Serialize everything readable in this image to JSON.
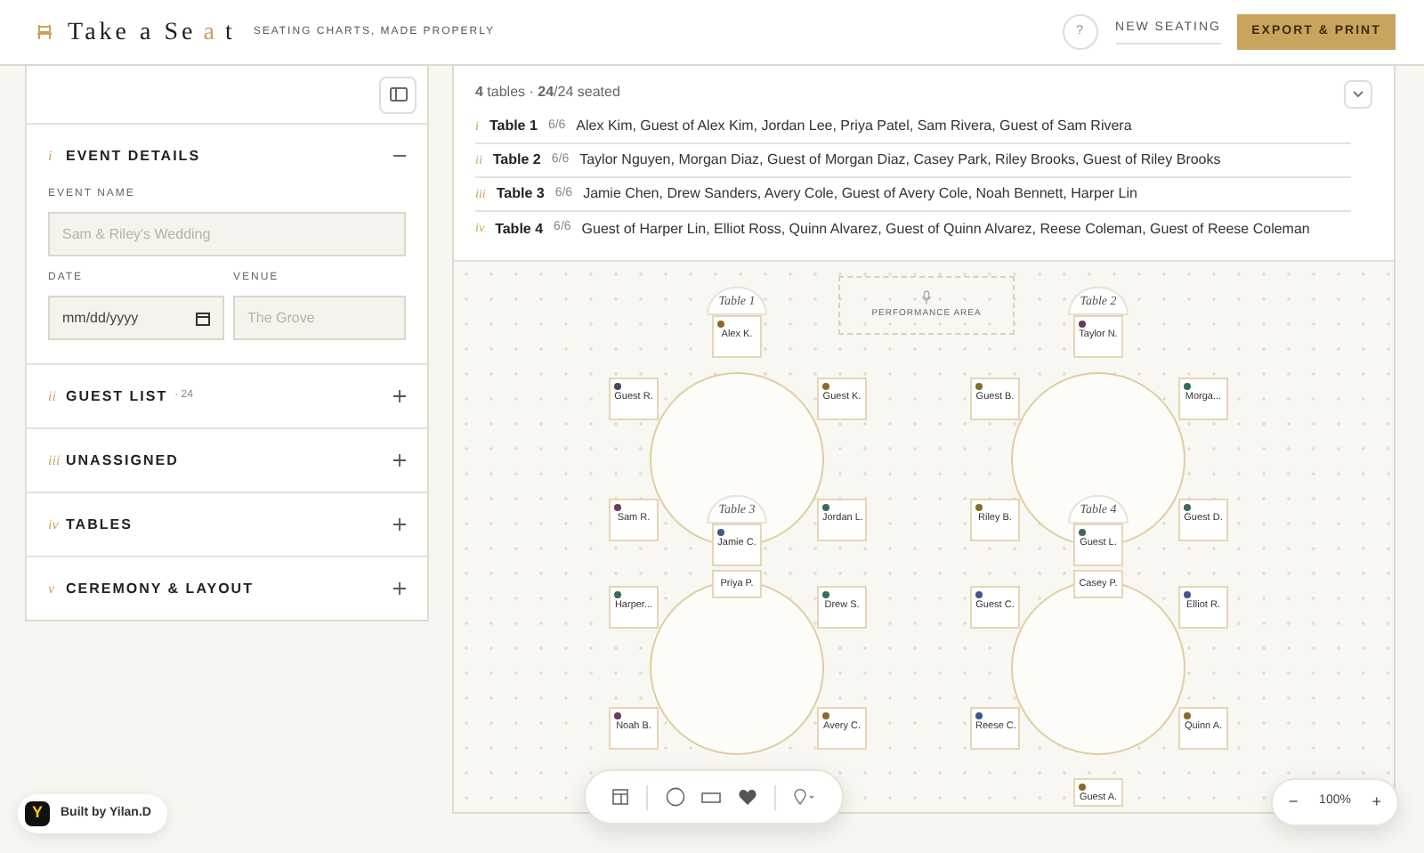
{
  "header": {
    "logo": {
      "before": "Take a Se",
      "accent": "a",
      "after": "t"
    },
    "tagline": "SEATING CHARTS, MADE PROPERLY",
    "help": "?",
    "new_seating": "NEW SEATING",
    "export": "EXPORT & PRINT"
  },
  "sidebar": {
    "sections": [
      {
        "numeral": "i",
        "title": "EVENT DETAILS",
        "expanded": true
      },
      {
        "numeral": "ii",
        "title": "GUEST LIST",
        "count": "· 24",
        "expanded": false
      },
      {
        "numeral": "iii",
        "title": "UNASSIGNED",
        "expanded": false
      },
      {
        "numeral": "iv",
        "title": "TABLES",
        "expanded": false
      },
      {
        "numeral": "v",
        "title": "CEREMONY & LAYOUT",
        "expanded": false
      }
    ],
    "event_details": {
      "event_name": {
        "label": "EVENT NAME",
        "placeholder": "Sam & Riley's Wedding"
      },
      "date": {
        "label": "DATE",
        "placeholder": "mm/dd/yyyy"
      },
      "venue": {
        "label": "VENUE",
        "placeholder": "The Grove"
      }
    }
  },
  "summary": {
    "text": "**4** tables · **24**/24 seated",
    "rows": [
      {
        "numeral": "i",
        "name": "Table 1",
        "count": "6/6",
        "guests": "Alex Kim, Guest of Alex Kim, Jordan Lee, Priya Patel, Sam Rivera, Guest of Sam Rivera"
      },
      {
        "numeral": "ii",
        "name": "Table 2",
        "count": "6/6",
        "guests": "Taylor Nguyen, Morgan Diaz, Guest of Morgan Diaz, Casey Park, Riley Brooks, Guest of Riley Brooks"
      },
      {
        "numeral": "iii",
        "name": "Table 3",
        "count": "6/6",
        "guests": "Jamie Chen, Drew Sanders, Avery Cole, Guest of Avery Cole, Noah Bennett, Harper Lin"
      },
      {
        "numeral": "iv",
        "name": "Table 4",
        "count": "6/6",
        "guests": "Guest of Harper Lin, Elliot Ross, Quinn Alvarez, Guest of Quinn Alvarez, Reese Coleman, Guest of Reese Coleman"
      }
    ]
  },
  "canvas": {
    "performance_area": "PERFORMANCE AREA",
    "tables": [
      {
        "label": "Table 1",
        "seats": [
          {
            "name": "Alex K.",
            "color": "#8a6a2a"
          },
          {
            "name": "Guest R.",
            "color": "#4a4a5a"
          },
          {
            "name": "Guest K.",
            "color": "#8a6a2a"
          },
          {
            "name": "Sam R.",
            "color": "#6b3a5a"
          },
          {
            "name": "Jordan L.",
            "color": "#3a6b5a"
          },
          {
            "name": "Priya P."
          }
        ]
      },
      {
        "label": "Table 2",
        "seats": [
          {
            "name": "Taylor N.",
            "color": "#6b3a5a"
          },
          {
            "name": "Guest B.",
            "color": "#8a6a2a"
          },
          {
            "name": "Morga...",
            "color": "#3a6b5a"
          },
          {
            "name": "Riley B.",
            "color": "#8a6a2a"
          },
          {
            "name": "Guest D.",
            "color": "#3a6b5a"
          },
          {
            "name": "Casey P."
          }
        ]
      },
      {
        "label": "Table 3",
        "seats": [
          {
            "name": "Jamie C.",
            "color": "#3a5a8a"
          },
          {
            "name": "Harper...",
            "color": "#3a6b5a"
          },
          {
            "name": "Drew S.",
            "color": "#3a6b5a"
          },
          {
            "name": "Noah B.",
            "color": "#6b3a5a"
          },
          {
            "name": "Avery C.",
            "color": "#8a6a2a"
          }
        ]
      },
      {
        "label": "Table 4",
        "seats": [
          {
            "name": "Guest L.",
            "color": "#3a6b5a"
          },
          {
            "name": "Guest C.",
            "color": "#3a5a8a"
          },
          {
            "name": "Elliot R.",
            "color": "#3a5a8a"
          },
          {
            "name": "Reese C.",
            "color": "#3a5a8a"
          },
          {
            "name": "Quinn A.",
            "color": "#8a6a2a"
          },
          {
            "name": "Guest A.",
            "color": "#8a6a2a"
          }
        ]
      }
    ],
    "zoom": {
      "minus": "−",
      "value": "100%",
      "plus": "+"
    }
  },
  "badge": {
    "logo": "Y",
    "text": "Built by Yilan.D"
  }
}
